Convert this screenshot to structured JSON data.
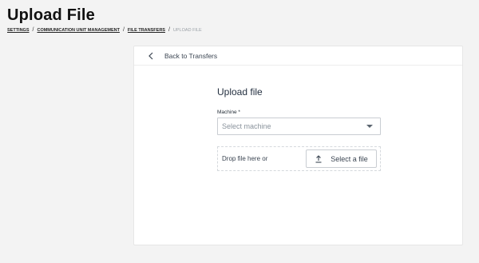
{
  "page": {
    "title": "Upload File"
  },
  "breadcrumb": {
    "items": [
      "SETTINGS",
      "COMMUNICATION UNIT MANAGEMENT",
      "FILE TRANSFERS"
    ],
    "current": "UPLOAD FILE",
    "separator": "/"
  },
  "card": {
    "back_label": "Back to Transfers",
    "form_title": "Upload file",
    "machine_label": "Machine *",
    "machine_placeholder": "Select machine",
    "drop_text": "Drop file here or",
    "select_file_label": "Select a file"
  },
  "icons": {
    "back": "chevron-left-icon",
    "select": "caret-down-icon",
    "upload": "upload-icon"
  }
}
